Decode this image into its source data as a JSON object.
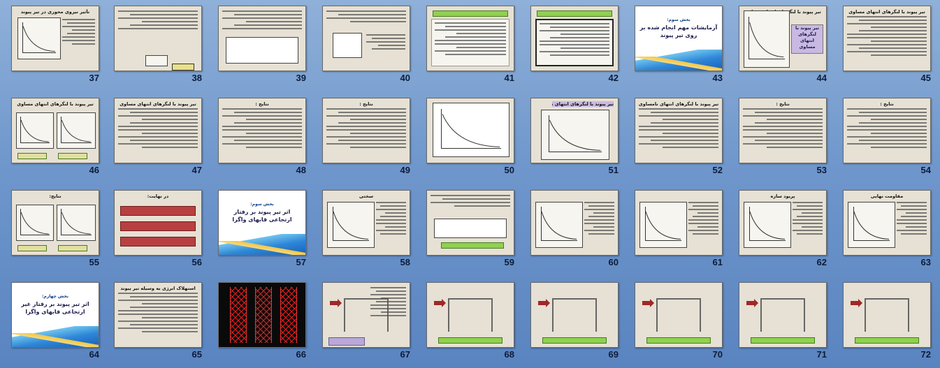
{
  "window": {
    "background": "#6f97cc"
  },
  "slides": [
    {
      "n": "45",
      "title": "تیر پیوند با لنگرهای انتهای مساوی",
      "kind": "text"
    },
    {
      "n": "44",
      "title": "تیر پیوند با لنگرهای انتهای مساوی",
      "kind": "figure-label"
    },
    {
      "n": "43",
      "title": "آزمایشات مهم انجام شده بر روی تیر پیوند",
      "part": "بخش سوم:",
      "kind": "section"
    },
    {
      "n": "42",
      "title": "",
      "kind": "text-green"
    },
    {
      "n": "41",
      "title": "",
      "kind": "text-green"
    },
    {
      "n": "40",
      "title": "",
      "kind": "formula"
    },
    {
      "n": "39",
      "title": "",
      "kind": "text-red"
    },
    {
      "n": "38",
      "title": "",
      "kind": "text-formula"
    },
    {
      "n": "37",
      "title": "تأثیر نیروی محوری در تیر پیوند",
      "kind": "text-figure"
    },
    {
      "n": "54",
      "title": "نتایج :",
      "kind": "text"
    },
    {
      "n": "53",
      "title": "نتایج :",
      "kind": "text"
    },
    {
      "n": "52",
      "title": "تیر پیوند با لنگرهای انتهای نامساوی",
      "kind": "text"
    },
    {
      "n": "51",
      "title": "تیر پیوند با لنگرهای انتهای نامساوی",
      "kind": "figure-purple"
    },
    {
      "n": "50",
      "title": "",
      "kind": "hysteresis"
    },
    {
      "n": "49",
      "title": "نتایج :",
      "kind": "text"
    },
    {
      "n": "48",
      "title": "نتایج :",
      "kind": "text"
    },
    {
      "n": "47",
      "title": "تیر پیوند با لنگرهای انتهای مساوی",
      "kind": "text"
    },
    {
      "n": "46",
      "title": "تیر پیوند با لنگرهای انتهای مساوی",
      "kind": "two-plots"
    },
    {
      "n": "63",
      "title": "مقاومت نهایی",
      "kind": "plot-text"
    },
    {
      "n": "62",
      "title": "پریود سازه",
      "kind": "plot-text"
    },
    {
      "n": "61",
      "title": "",
      "kind": "plot-text"
    },
    {
      "n": "60",
      "title": "",
      "kind": "plot-text"
    },
    {
      "n": "59",
      "title": "",
      "kind": "table"
    },
    {
      "n": "58",
      "title": "سختی",
      "kind": "plot-text"
    },
    {
      "n": "57",
      "title": "اثر تیر پیوند بر رفتار ارتجاعی قابهای واگرا",
      "part": "بخش سوم:",
      "kind": "section"
    },
    {
      "n": "56",
      "title": "در نهایت:",
      "kind": "red-boxes"
    },
    {
      "n": "55",
      "title": "نتایج:",
      "kind": "two-plots"
    },
    {
      "n": "72",
      "title": "",
      "kind": "frame"
    },
    {
      "n": "71",
      "title": "",
      "kind": "frame"
    },
    {
      "n": "70",
      "title": "",
      "kind": "frame"
    },
    {
      "n": "69",
      "title": "",
      "kind": "frame"
    },
    {
      "n": "68",
      "title": "",
      "kind": "frame"
    },
    {
      "n": "67",
      "title": "",
      "kind": "frame-text"
    },
    {
      "n": "66",
      "title": "",
      "kind": "towers"
    },
    {
      "n": "65",
      "title": "استهلاک انرژی به وسیله تیر پیوند",
      "kind": "text"
    },
    {
      "n": "64",
      "title": "اثر تیر پیوند بر رفتار غیر ارتجاعی قابهای واگرا",
      "part": "بخش چهارم:",
      "kind": "section"
    }
  ]
}
